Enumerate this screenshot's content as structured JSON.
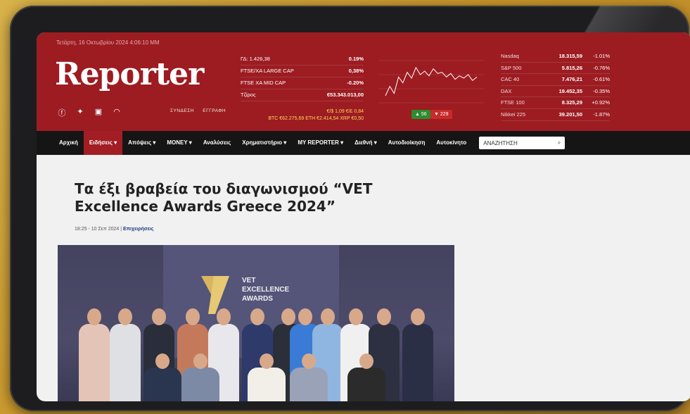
{
  "header": {
    "date": "Τετάρτη, 16 Οκτωβρίου 2024 4:06:10 ΜΜ",
    "logo": "Reporter",
    "auth": {
      "login": "ΣΥΝΔΕΣΗ",
      "register": "ΕΓΓΡΑΦΗ"
    },
    "social_icons": [
      "facebook-icon",
      "twitter-icon",
      "print-icon",
      "rss-icon"
    ]
  },
  "market": [
    {
      "name": "ΓΔ: 1.426,38",
      "value": "0.19%"
    },
    {
      "name": "FTSE/XA LARGE CAP",
      "value": "0,38%"
    },
    {
      "name": "FTSE XA MID CAP",
      "value": "-0.20%"
    },
    {
      "name": "Τζίρος",
      "value": "€53.343.013,00"
    }
  ],
  "fx": {
    "line1": "€/$ 1,09  €/£ 0,84",
    "line2": "BTC €62.275,69  ETH €2.414,54  XRP €0,50"
  },
  "chart_buttons": {
    "up": "▲ 56",
    "down": "▼ 229"
  },
  "chart_data": {
    "type": "line",
    "values": [
      1.0,
      1.8,
      1.2,
      2.6,
      2.1,
      3.0,
      2.5,
      3.4,
      2.8,
      3.1,
      2.7,
      3.3,
      2.9,
      3.0,
      2.6,
      2.9,
      2.4,
      2.7,
      2.5,
      2.8,
      2.3,
      2.6
    ]
  },
  "indices": [
    {
      "name": "Nasdaq",
      "value": "18.315,59",
      "change": "-1.01%"
    },
    {
      "name": "S&P 500",
      "value": "5.815,26",
      "change": "-0.76%"
    },
    {
      "name": "CAC 40",
      "value": "7.476,21",
      "change": "-0.61%"
    },
    {
      "name": "DAX",
      "value": "19.452,35",
      "change": "-0.35%"
    },
    {
      "name": "FTSE 100",
      "value": "8.325,29",
      "change": "+0.92%"
    },
    {
      "name": "Nikkei 225",
      "value": "39.201,50",
      "change": "-1.87%"
    }
  ],
  "nav": {
    "items": [
      "Αρχική",
      "Ειδήσεις",
      "Απόψεις",
      "MONEY",
      "Αναλύσεις",
      "Χρηματιστήριο",
      "MY REPORTER",
      "Διεθνή",
      "Αυτοδιοίκηση",
      "Αυτοκίνητο"
    ],
    "search_placeholder": "ΑΝΑΖΗΤΗΣΗ"
  },
  "article": {
    "title": "Τα έξι βραβεία του διαγωνισμού “VET Excellence Awards Greece 2024”",
    "time": "18:25 - 10 Σεπ 2024 |",
    "category": "Επιχειρήσεις",
    "photo_text": "VET EXCELLENCE AWARDS"
  }
}
